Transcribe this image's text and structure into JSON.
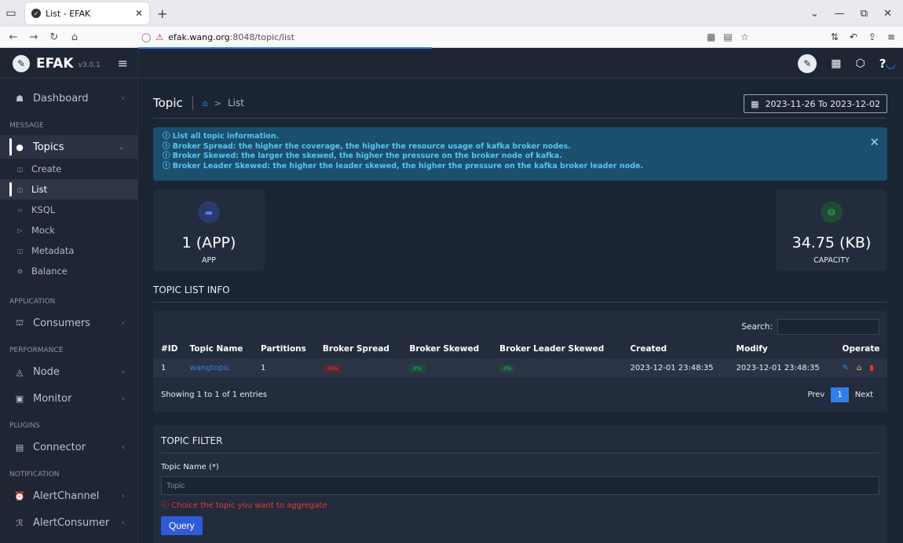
{
  "browser": {
    "tab_title": "List - EFAK",
    "url_host": "efak.wang.org",
    "url_path": ":8048/topic/list"
  },
  "brand": {
    "name": "EFAK",
    "version": "v3.0.1"
  },
  "sidebar": {
    "dashboard": "Dashboard",
    "sec_message": "MESSAGE",
    "topics": "Topics",
    "sub": [
      "Create",
      "List",
      "KSQL",
      "Mock",
      "Metadata",
      "Balance"
    ],
    "sec_application": "APPLICATION",
    "consumers": "Consumers",
    "sec_performance": "PERFORMANCE",
    "node": "Node",
    "monitor": "Monitor",
    "sec_plugins": "PLUGINS",
    "connector": "Connector",
    "sec_notification": "NOTIFICATION",
    "alertchannel": "AlertChannel",
    "alertconsumer": "AlertConsumer"
  },
  "header": {
    "title": "Topic",
    "crumb": "List",
    "daterange": "2023-11-26 To 2023-12-02"
  },
  "alert": {
    "lines": [
      "ⓘ List all topic information.",
      "ⓘ Broker Spread: the higher the coverage, the higher the resource usage of kafka broker nodes.",
      "ⓘ Broker Skewed: the larger the skewed, the higher the pressure on the broker node of kafka.",
      "ⓘ Broker Leader Skewed: the higher the leader skewed, the higher the pressure on the kafka broker leader node."
    ]
  },
  "stats": {
    "app": {
      "value": "1 (APP)",
      "label": "APP",
      "color": "#2f4fbf"
    },
    "capacity": {
      "value": "34.75 (KB)",
      "label": "CAPACITY",
      "color": "#1f6b3a"
    }
  },
  "topic_list": {
    "title": "TOPIC LIST INFO",
    "search_label": "Search:",
    "columns": [
      "#ID",
      "Topic Name",
      "Partitions",
      "Broker Spread",
      "Broker Skewed",
      "Broker Leader Skewed",
      "Created",
      "Modify",
      "Operate"
    ],
    "rows": [
      {
        "id": "1",
        "name": "wangtopic",
        "partitions": "1",
        "spread": "33%",
        "skewed": "0%",
        "leader_skewed": "0%",
        "created": "2023-12-01 23:48:35",
        "modify": "2023-12-01 23:48:35"
      }
    ],
    "showing": "Showing 1 to 1 of 1 entries",
    "prev": "Prev",
    "page": "1",
    "next": "Next"
  },
  "filter": {
    "title": "TOPIC FILTER",
    "label": "Topic Name (*)",
    "placeholder": "Topic",
    "hint": "ⓘ Choice the topic you want to aggregate .",
    "button": "Query"
  }
}
